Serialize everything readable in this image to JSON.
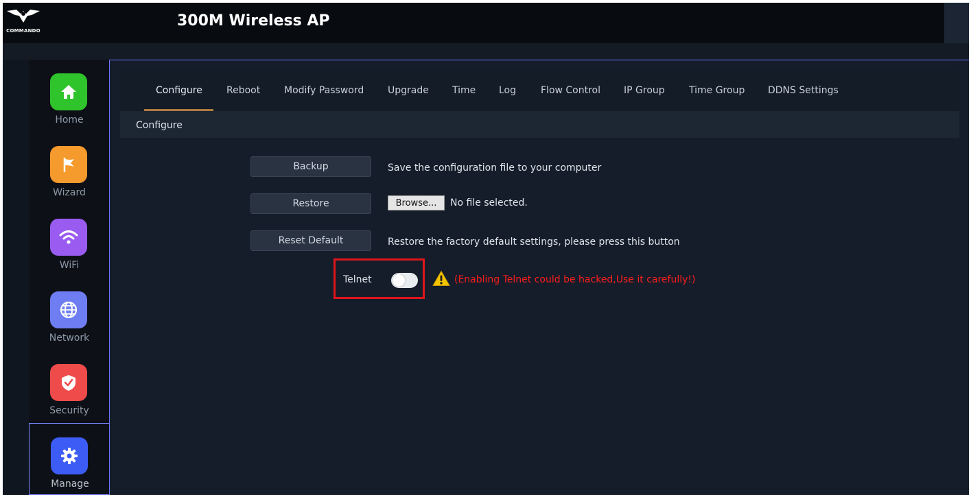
{
  "app": {
    "title": "300M Wireless AP",
    "brand": "COMMANDO"
  },
  "sidebar": {
    "items": [
      {
        "label": "Home",
        "icon": "home-icon",
        "color": "#2fc42b",
        "active": false
      },
      {
        "label": "Wizard",
        "icon": "flag-icon",
        "color": "#f59a2d",
        "active": false
      },
      {
        "label": "WiFi",
        "icon": "wifi-icon",
        "color": "#9a5cf0",
        "active": false
      },
      {
        "label": "Network",
        "icon": "globe-icon",
        "color": "#6f7df2",
        "active": false
      },
      {
        "label": "Security",
        "icon": "shield-icon",
        "color": "#ef4b4b",
        "active": false
      },
      {
        "label": "Manage",
        "icon": "gear-icon",
        "color": "#3d5cf5",
        "active": true
      }
    ]
  },
  "tabs": [
    {
      "label": "Configure",
      "active": true
    },
    {
      "label": "Reboot"
    },
    {
      "label": "Modify Password"
    },
    {
      "label": "Upgrade"
    },
    {
      "label": "Time"
    },
    {
      "label": "Log"
    },
    {
      "label": "Flow Control"
    },
    {
      "label": "IP Group"
    },
    {
      "label": "Time Group"
    },
    {
      "label": "DDNS Settings"
    }
  ],
  "section": {
    "title": "Configure"
  },
  "actions": {
    "backup": {
      "label": "Backup",
      "description": "Save the configuration file to your computer"
    },
    "restore": {
      "label": "Restore",
      "browse_label": "Browse...",
      "file_status": "No file selected."
    },
    "reset": {
      "label": "Reset Default",
      "description": "Restore the factory default settings, please press this button"
    }
  },
  "telnet": {
    "label": "Telnet",
    "enabled": false,
    "warning": "(Enabling Telnet could be hacked,Use it carefully!)",
    "warning_icon": "warning-icon",
    "highlight_color": "#e0151b"
  }
}
